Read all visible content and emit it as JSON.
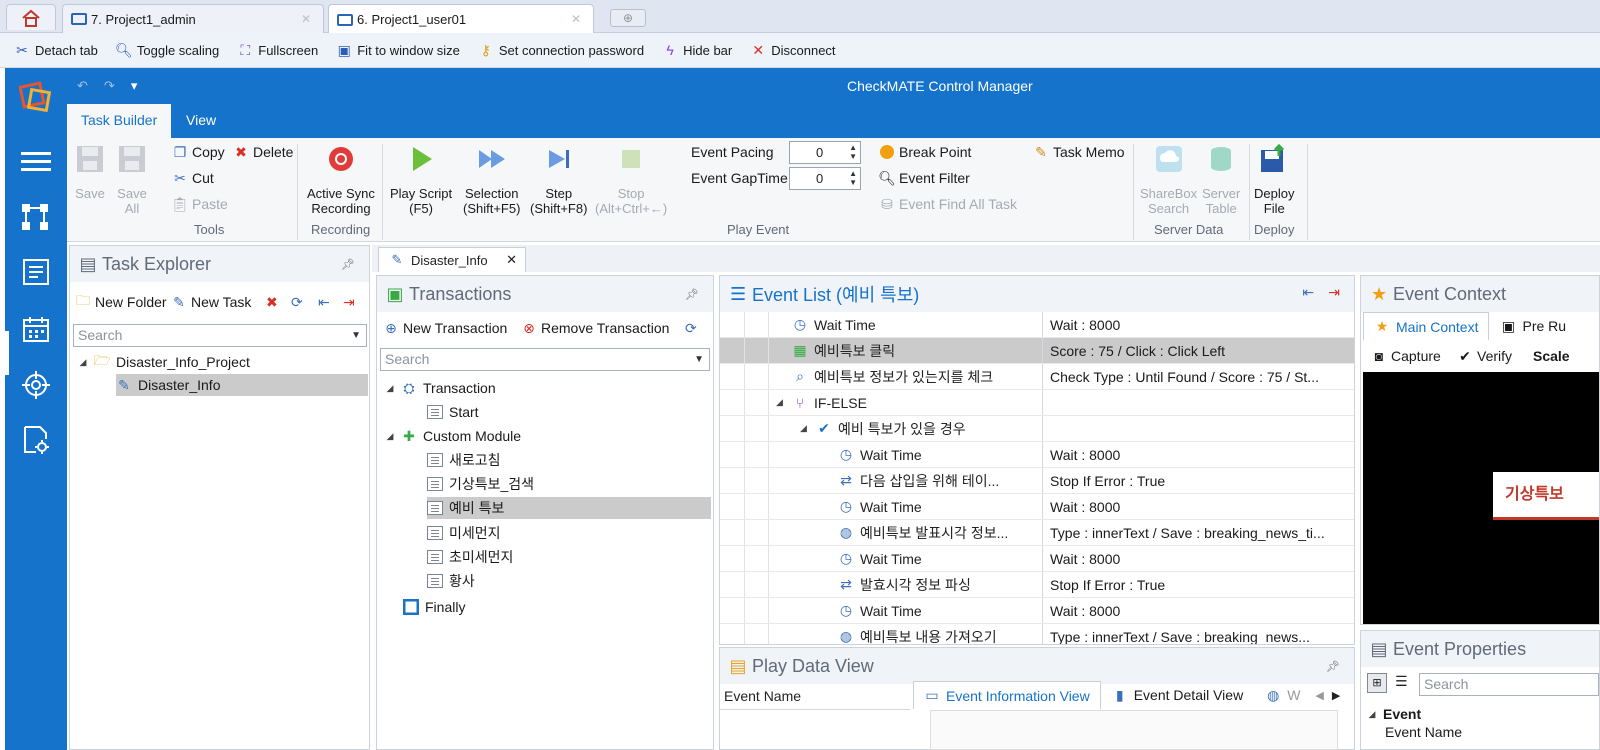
{
  "browser_tabs": [
    {
      "label": "7. Project1_admin"
    },
    {
      "label": "6. Project1_user01"
    }
  ],
  "rdp_toolbar": {
    "detach": "Detach tab",
    "toggle_scaling": "Toggle scaling",
    "fullscreen": "Fullscreen",
    "fit": "Fit to window size",
    "password": "Set connection password",
    "hide_bar": "Hide bar",
    "disconnect": "Disconnect"
  },
  "app": {
    "title": "CheckMATE Control Manager",
    "ribbon_tabs": [
      "Task Builder",
      "View"
    ]
  },
  "ribbon": {
    "tools": {
      "save": "Save",
      "save_all_1": "Save",
      "save_all_2": "All",
      "copy": "Copy",
      "delete": "Delete",
      "cut": "Cut",
      "paste": "Paste",
      "label": "Tools"
    },
    "recording": {
      "active_1": "Active Sync",
      "active_2": "Recording",
      "label": "Recording"
    },
    "play": {
      "play_1": "Play Script",
      "play_2": "(F5)",
      "sel_1": "Selection",
      "sel_2": "(Shift+F5)",
      "step_1": "Step",
      "step_2": "(Shift+F8)",
      "stop_1": "Stop",
      "stop_2": "(Alt+Ctrl+←)",
      "pacing_label": "Event Pacing",
      "pacing_value": "0",
      "gap_label": "Event GapTime",
      "gap_value": "0",
      "break_point": "Break Point",
      "event_filter": "Event Filter",
      "find_all": "Event Find All Task",
      "task_memo": "Task Memo",
      "label": "Play Event"
    },
    "server": {
      "sharebox_1": "ShareBox",
      "sharebox_2": "Search",
      "table_1": "Server",
      "table_2": "Table",
      "label": "Server Data"
    },
    "deploy": {
      "file_1": "Deploy",
      "file_2": "File",
      "label": "Deploy"
    }
  },
  "doc_tab": "Disaster_Info",
  "task_explorer": {
    "title": "Task Explorer",
    "new_folder": "New Folder",
    "new_task": "New Task",
    "search_placeholder": "Search",
    "project": "Disaster_Info_Project",
    "task": "Disaster_Info"
  },
  "transactions": {
    "title": "Transactions",
    "new": "New Transaction",
    "remove": "Remove Transaction",
    "search_placeholder": "Search",
    "transaction": "Transaction",
    "start": "Start",
    "custom_module": "Custom Module",
    "modules": [
      "새로고침",
      "기상특보_검색",
      "예비 특보",
      "미세먼지",
      "초미세먼지",
      "황사"
    ],
    "finally": "Finally"
  },
  "event_list": {
    "title": "Event List (예비 특보)",
    "rows": [
      {
        "name": "Wait Time",
        "value": "Wait : 8000"
      },
      {
        "name": "예비특보 클릭",
        "value": "Score : 75 / Click : Click Left"
      },
      {
        "name": "예비특보 정보가 있는지를 체크",
        "value": "Check Type : Until Found / Score : 75 / St..."
      },
      {
        "name": "IF-ELSE",
        "value": ""
      },
      {
        "name": "예비 특보가 있을 경우",
        "value": ""
      },
      {
        "name": "Wait Time",
        "value": "Wait : 8000"
      },
      {
        "name": "다음 삽입을 위해 테이...",
        "value": "Stop If Error : True"
      },
      {
        "name": "Wait Time",
        "value": "Wait : 8000"
      },
      {
        "name": "예비특보 발표시각 정보...",
        "value": "Type : innerText / Save : breaking_news_ti..."
      },
      {
        "name": "Wait Time",
        "value": "Wait : 8000"
      },
      {
        "name": "발효시각 정보 파싱",
        "value": "Stop If Error : True"
      },
      {
        "name": "Wait Time",
        "value": "Wait : 8000"
      },
      {
        "name": "예비특보 내용 가져오기",
        "value": "Type : innerText / Save : breaking_news..."
      }
    ]
  },
  "event_context": {
    "title": "Event Context",
    "tab_main": "Main Context",
    "tab_pre": "Pre Ru",
    "capture": "Capture",
    "verify": "Verify",
    "scale": "Scale",
    "preview_text": "기상특보"
  },
  "play_data": {
    "title": "Play Data View",
    "col_event_name": "Event Name",
    "tab_info": "Event Information View",
    "tab_detail": "Event Detail View",
    "tab_w": "W"
  },
  "event_properties": {
    "title": "Event Properties",
    "search_placeholder": "Search",
    "section": "Event",
    "row": "Event Name"
  },
  "colors": {
    "accent": "#1673cc",
    "selection": "#cbcbcb"
  }
}
